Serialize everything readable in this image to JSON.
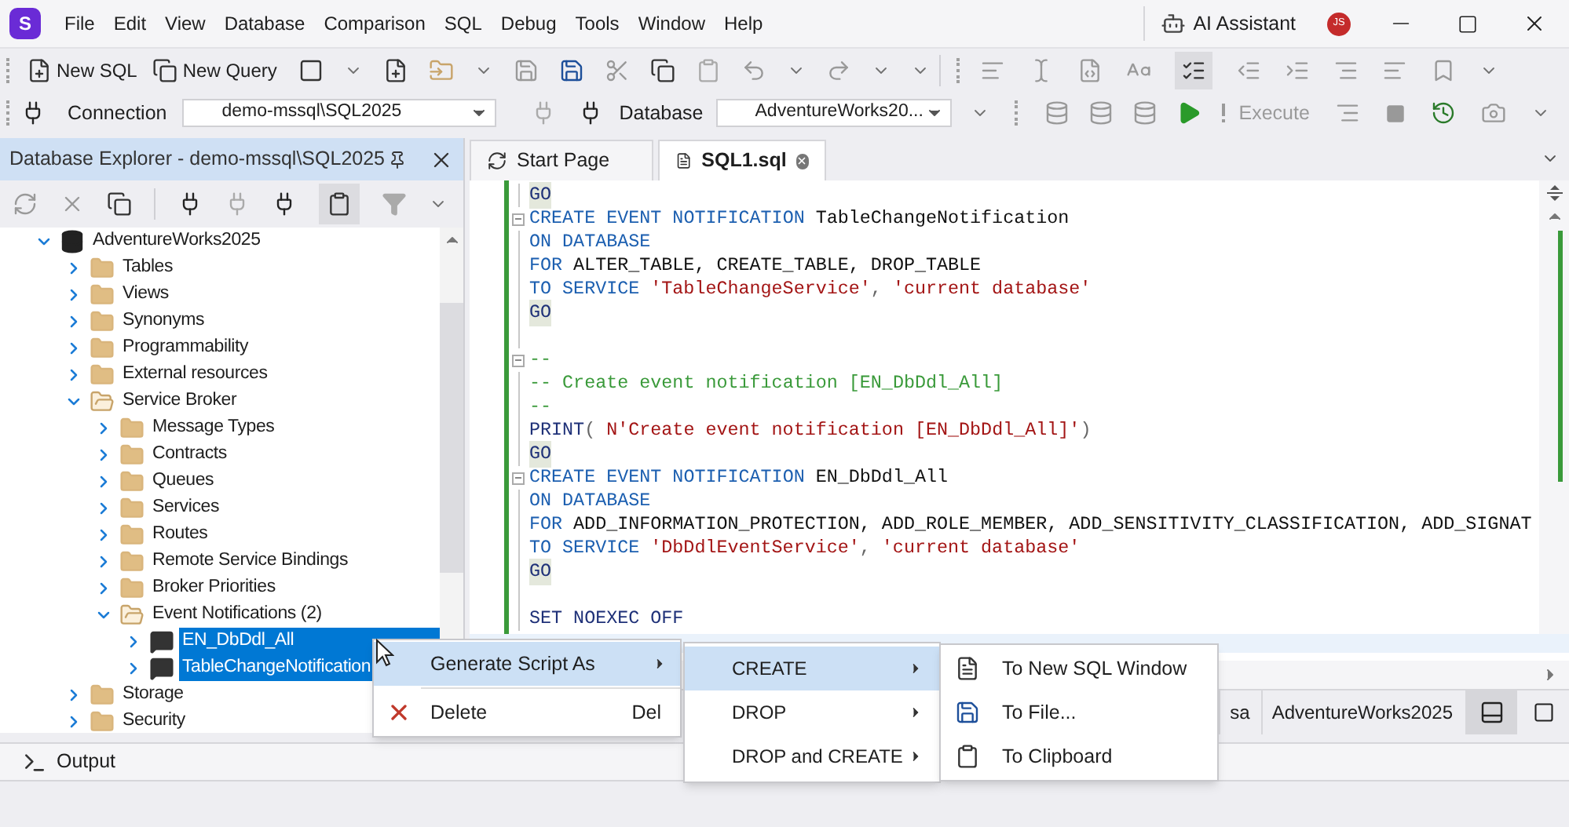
{
  "app": {
    "logo_letter": "S",
    "ai_assistant": "AI Assistant",
    "avatar": "JS"
  },
  "menus": [
    "File",
    "Edit",
    "View",
    "Database",
    "Comparison",
    "SQL",
    "Debug",
    "Tools",
    "Window",
    "Help"
  ],
  "toolbar": {
    "new_sql": "New SQL",
    "new_query": "New Query",
    "connection_label": "Connection",
    "connection": "demo-mssql\\SQL2025",
    "database_label": "Database",
    "database": "AdventureWorks20...",
    "execute": {
      "label": "Execute",
      "disabled": true
    }
  },
  "explorer": {
    "title": "Database Explorer - demo-mssql\\SQL2025",
    "tree": [
      {
        "label": "AdventureWorks2025",
        "kind": "database",
        "expanded": true,
        "selected": false,
        "children": [
          {
            "label": "Tables",
            "kind": "folder",
            "expanded": false,
            "selected": false
          },
          {
            "label": "Views",
            "kind": "folder",
            "expanded": false,
            "selected": false
          },
          {
            "label": "Synonyms",
            "kind": "folder",
            "expanded": false,
            "selected": false
          },
          {
            "label": "Programmability",
            "kind": "folder",
            "expanded": false,
            "selected": false
          },
          {
            "label": "External resources",
            "kind": "folder",
            "expanded": false,
            "selected": false
          },
          {
            "label": "Service Broker",
            "kind": "folder",
            "expanded": true,
            "selected": false,
            "children": [
              {
                "label": "Message Types",
                "kind": "folder",
                "expanded": false,
                "selected": false
              },
              {
                "label": "Contracts",
                "kind": "folder",
                "expanded": false,
                "selected": false
              },
              {
                "label": "Queues",
                "kind": "folder",
                "expanded": false,
                "selected": false
              },
              {
                "label": "Services",
                "kind": "folder",
                "expanded": false,
                "selected": false
              },
              {
                "label": "Routes",
                "kind": "folder",
                "expanded": false,
                "selected": false
              },
              {
                "label": "Remote Service Bindings",
                "kind": "folder",
                "expanded": false,
                "selected": false
              },
              {
                "label": "Broker Priorities",
                "kind": "folder",
                "expanded": false,
                "selected": false
              },
              {
                "label": "Event Notifications (2)",
                "kind": "folder",
                "expanded": true,
                "selected": false,
                "children": [
                  {
                    "label": "EN_DbDdl_All",
                    "kind": "notification",
                    "expanded": false,
                    "selected": true
                  },
                  {
                    "label": "TableChangeNotification",
                    "kind": "notification",
                    "expanded": false,
                    "selected": true
                  }
                ]
              }
            ]
          },
          {
            "label": "Storage",
            "kind": "folder",
            "expanded": false,
            "selected": false
          },
          {
            "label": "Security",
            "kind": "folder",
            "expanded": false,
            "selected": false
          }
        ]
      }
    ]
  },
  "tabs": [
    {
      "label": "Start Page",
      "selected": false
    },
    {
      "label": "SQL1.sql",
      "selected": true
    }
  ],
  "code": [
    {
      "fold": false,
      "tokens": [
        {
          "text": "GO",
          "kind": "batch"
        }
      ]
    },
    {
      "fold": true,
      "tokens": [
        {
          "text": "CREATE EVENT NOTIFICATION",
          "kind": "kw"
        },
        {
          "text": "TableChangeNotification",
          "kind": "id"
        }
      ]
    },
    {
      "fold": false,
      "tokens": [
        {
          "text": "ON DATABASE",
          "kind": "kw"
        }
      ]
    },
    {
      "fold": false,
      "tokens": [
        {
          "text": "FOR",
          "kind": "kw"
        },
        {
          "text": "ALTER_TABLE, CREATE_TABLE, DROP_TABLE",
          "kind": "id"
        }
      ]
    },
    {
      "fold": false,
      "tokens": [
        {
          "text": "TO SERVICE",
          "kind": "kw"
        },
        {
          "text": "'TableChangeService'",
          "kind": "str"
        },
        {
          "text": ",",
          "kind": "punct"
        },
        {
          "text": "'current database'",
          "kind": "str"
        }
      ]
    },
    {
      "fold": false,
      "tokens": [
        {
          "text": "GO",
          "kind": "batch"
        }
      ]
    },
    {
      "fold": false
    },
    {
      "fold": true,
      "tokens": [
        {
          "text": "--",
          "kind": "cmt"
        }
      ]
    },
    {
      "fold": false,
      "tokens": [
        {
          "text": "-- Create event notification [EN_DbDdl_All]",
          "kind": "cmt"
        }
      ]
    },
    {
      "fold": false,
      "tokens": [
        {
          "text": "--",
          "kind": "cmt"
        }
      ]
    },
    {
      "fold": false,
      "tokens": [
        {
          "text": "PRINT",
          "kind": "fn"
        },
        {
          "text": "(",
          "kind": "punct"
        },
        {
          "text": "N'Create event notification [EN_DbDdl_All]'",
          "kind": "str"
        },
        {
          "text": ")",
          "kind": "punct"
        }
      ]
    },
    {
      "fold": false,
      "tokens": [
        {
          "text": "GO",
          "kind": "batch"
        }
      ]
    },
    {
      "fold": true,
      "tokens": [
        {
          "text": "CREATE EVENT NOTIFICATION",
          "kind": "kw"
        },
        {
          "text": "EN_DbDdl_All",
          "kind": "id"
        }
      ]
    },
    {
      "fold": false,
      "tokens": [
        {
          "text": "ON DATABASE",
          "kind": "kw"
        }
      ]
    },
    {
      "fold": false,
      "tokens": [
        {
          "text": "FOR",
          "kind": "kw"
        },
        {
          "text": "ADD_INFORMATION_PROTECTION, ADD_ROLE_MEMBER, ADD_SENSITIVITY_CLASSIFICATION, ADD_SIGNAT",
          "kind": "id"
        }
      ]
    },
    {
      "fold": false,
      "tokens": [
        {
          "text": "TO SERVICE",
          "kind": "kw"
        },
        {
          "text": "'DbDdlEventService'",
          "kind": "str"
        },
        {
          "text": ",",
          "kind": "punct"
        },
        {
          "text": "'current database'",
          "kind": "str"
        }
      ]
    },
    {
      "fold": false,
      "tokens": [
        {
          "text": "GO",
          "kind": "batch"
        }
      ]
    },
    {
      "fold": false
    },
    {
      "fold": false,
      "tokens": [
        {
          "text": "SET NOEXEC OFF",
          "kind": "fn"
        }
      ]
    }
  ],
  "editor_status": [
    "sa",
    "AdventureWorks2025"
  ],
  "context_menu": [
    {
      "label": "Generate Script As",
      "kind": "submenu",
      "selected": true
    },
    {
      "label": "Delete",
      "kind": "command",
      "shortcut": "Del",
      "selected": false
    }
  ],
  "submenu": [
    {
      "label": "CREATE",
      "selected": true
    },
    {
      "label": "DROP",
      "selected": false
    },
    {
      "label": "DROP and CREATE",
      "selected": false
    }
  ],
  "submenu_2": [
    {
      "label": "To New SQL Window"
    },
    {
      "label": "To File..."
    },
    {
      "label": "To Clipboard"
    }
  ],
  "output": {
    "label": "Output"
  }
}
